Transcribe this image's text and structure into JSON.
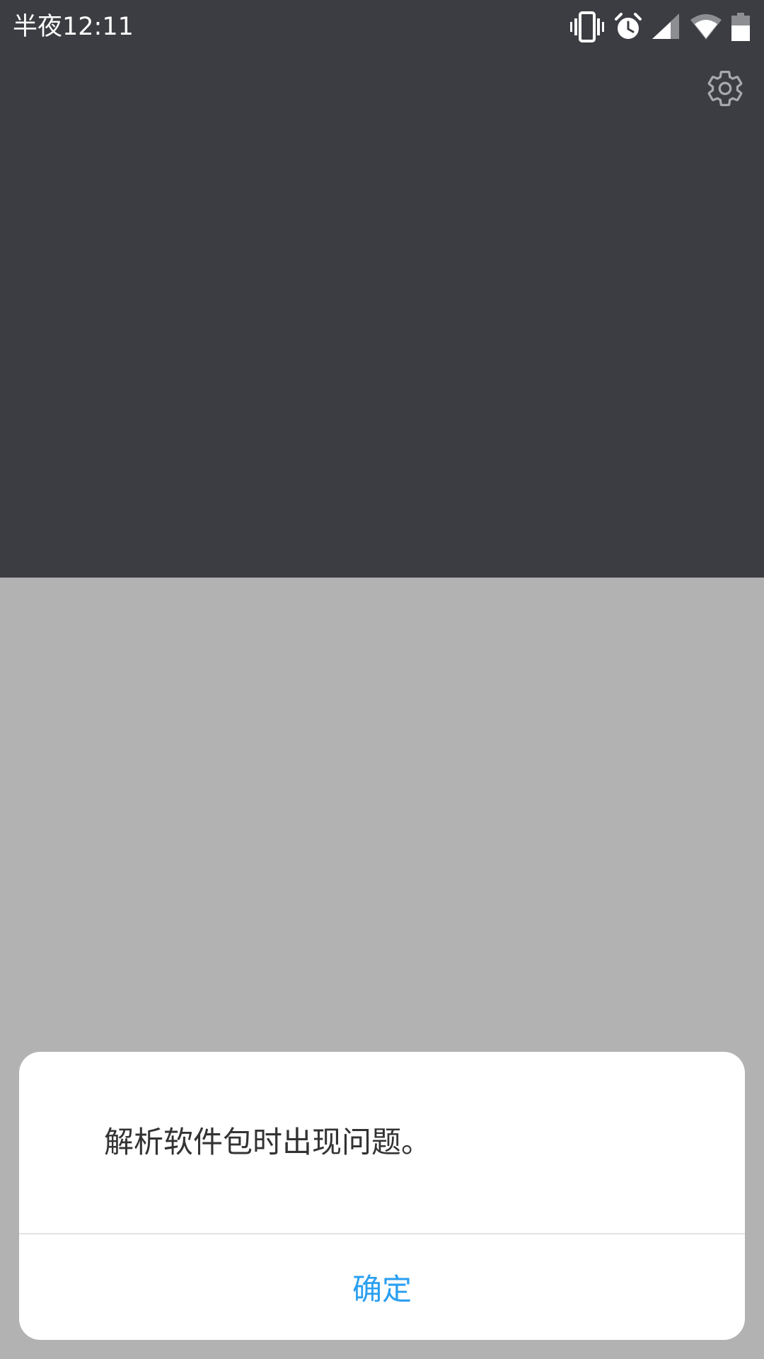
{
  "status_bar": {
    "time": "半夜12:11",
    "icons": [
      "vibrate-icon",
      "alarm-icon",
      "cell-signal-icon",
      "wifi-icon",
      "battery-icon"
    ]
  },
  "toolbar": {
    "settings_icon": "gear-icon"
  },
  "dialog": {
    "message": "解析软件包时出现问题。",
    "confirm_label": "确定"
  },
  "colors": {
    "header_bg": "#3c3d42",
    "scrim": "#b2b2b2",
    "dialog_bg": "#ffffff",
    "accent": "#2a9ff0",
    "message_text": "#333333"
  }
}
